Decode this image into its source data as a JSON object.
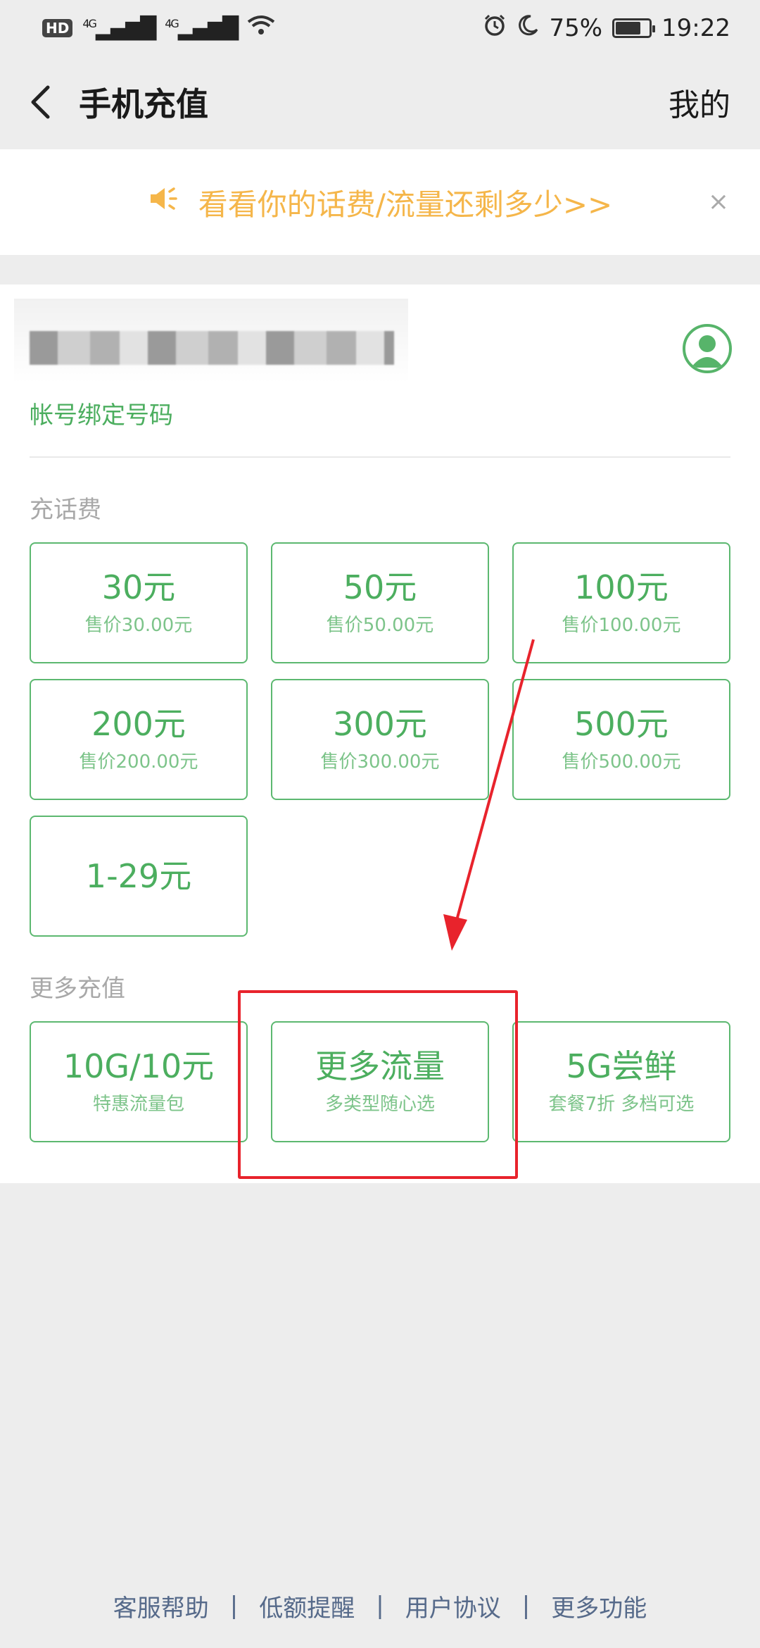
{
  "status_bar": {
    "hd": "HD",
    "sim": "1",
    "signal1": "4G",
    "signal2": "4G",
    "battery_pct": "75%",
    "time": "19:22"
  },
  "header": {
    "title": "手机充值",
    "mine_label": "我的"
  },
  "notice": {
    "text": "看看你的话费/流量还剩多少>>",
    "close": "×"
  },
  "account": {
    "bind_label": "帐号绑定号码"
  },
  "recharge": {
    "section_label": "充话费",
    "options": [
      {
        "amount": "30元",
        "price": "售价30.00元"
      },
      {
        "amount": "50元",
        "price": "售价50.00元"
      },
      {
        "amount": "100元",
        "price": "售价100.00元"
      },
      {
        "amount": "200元",
        "price": "售价200.00元"
      },
      {
        "amount": "300元",
        "price": "售价300.00元"
      },
      {
        "amount": "500元",
        "price": "售价500.00元"
      },
      {
        "amount": "1-29元",
        "price": ""
      }
    ]
  },
  "more": {
    "section_label": "更多充值",
    "options": [
      {
        "title": "10G/10元",
        "desc": "特惠流量包"
      },
      {
        "title": "更多流量",
        "desc": "多类型随心选"
      },
      {
        "title": "5G尝鲜",
        "desc": "套餐7折 多档可选"
      }
    ]
  },
  "footer": {
    "links": [
      "客服帮助",
      "低额提醒",
      "用户协议",
      "更多功能"
    ],
    "separator": "|"
  },
  "colors": {
    "accent_green": "#4cae5f",
    "notice_orange": "#f5b64a",
    "annotation_red": "#e8232c",
    "footer_link": "#566a8a"
  }
}
